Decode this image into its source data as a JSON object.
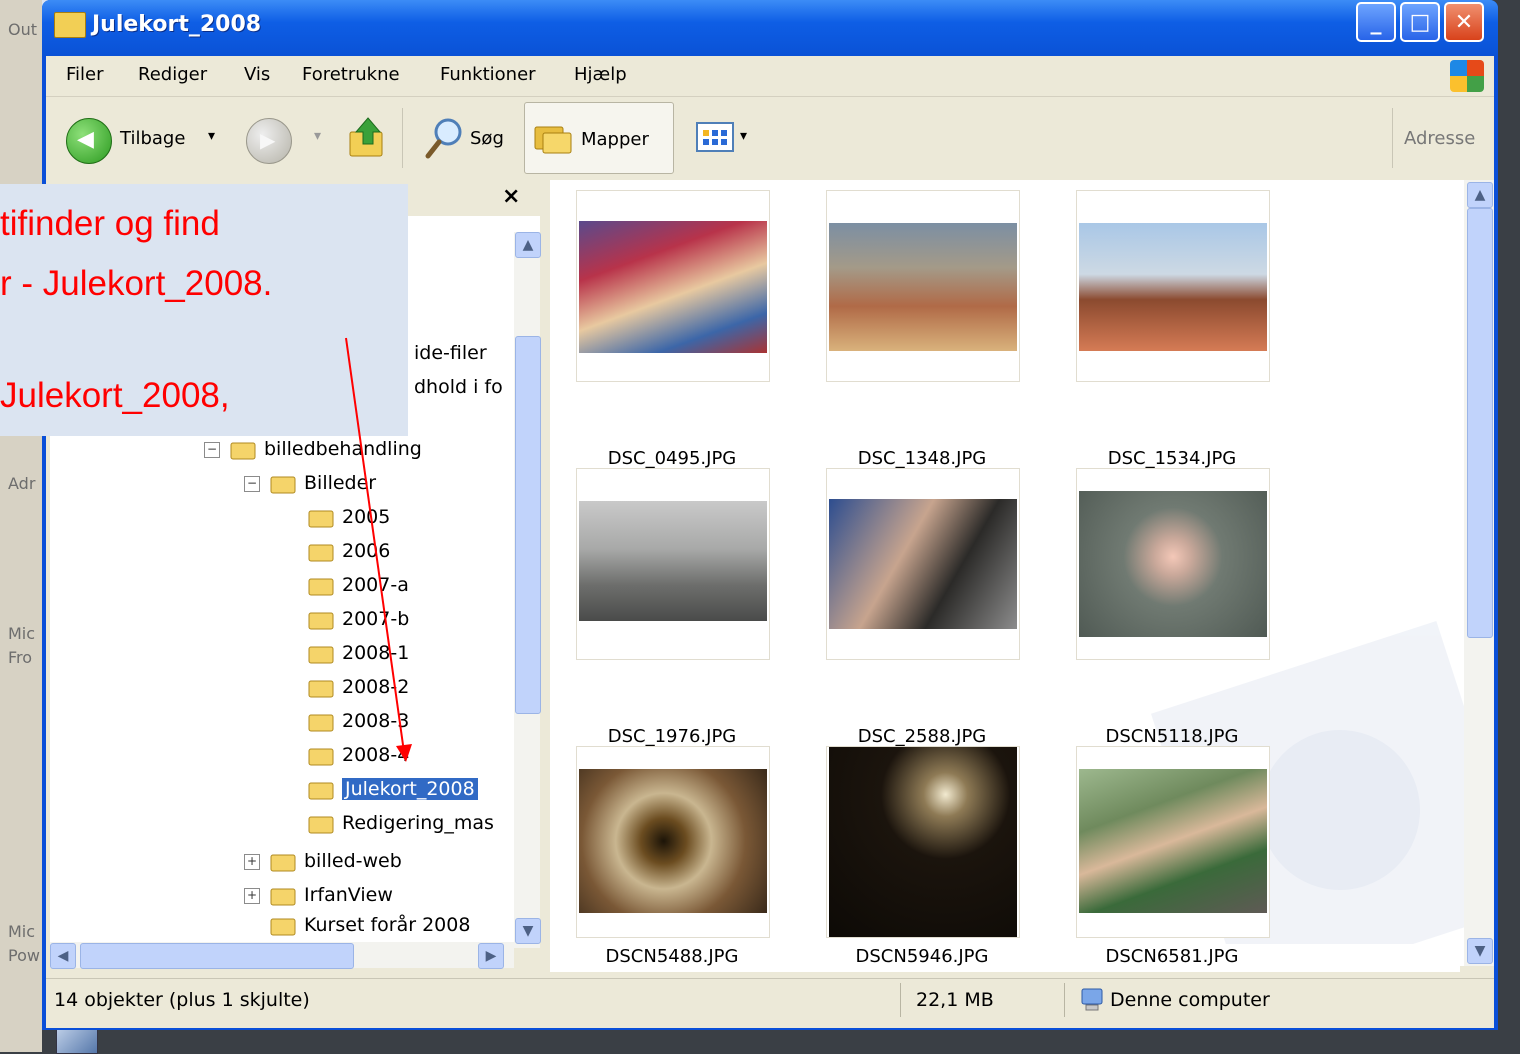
{
  "desktop": {
    "labels": [
      "Out",
      "Adr",
      "Mic",
      "Fro",
      "Mic",
      "Pow"
    ]
  },
  "window": {
    "title": "Julekort_2008",
    "buttons": {
      "min": "_",
      "max": "□",
      "close": "✕"
    }
  },
  "menu": {
    "items": [
      "Filer",
      "Rediger",
      "Vis",
      "Foretrukne",
      "Funktioner",
      "Hjælp"
    ]
  },
  "toolbar": {
    "back_label": "Tilbage",
    "dropdown_arrow": "▾",
    "search_label": "Søg",
    "folders_label": "Mapper",
    "address_label": "Adresse"
  },
  "folder_pane": {
    "close_label": "×",
    "partial_rows": [
      "ide-filer",
      "dhold i fo"
    ],
    "tree": [
      {
        "label": "billedbehandling",
        "expander": "−"
      },
      {
        "label": "Billeder",
        "expander": "−"
      },
      {
        "label": "2005"
      },
      {
        "label": "2006"
      },
      {
        "label": "2007-a"
      },
      {
        "label": "2007-b"
      },
      {
        "label": "2008-1"
      },
      {
        "label": "2008-2"
      },
      {
        "label": "2008-3"
      },
      {
        "label": "2008-4"
      },
      {
        "label": "Julekort_2008",
        "selected": true
      },
      {
        "label": "Redigering_mas"
      },
      {
        "label": "billed-web",
        "expander": "+"
      },
      {
        "label": "IrfanView",
        "expander": "+"
      },
      {
        "label": "Kurset forår 2008"
      }
    ]
  },
  "files": [
    {
      "name": "DSC_0495.JPG"
    },
    {
      "name": "DSC_1348.JPG"
    },
    {
      "name": "DSC_1534.JPG"
    },
    {
      "name": "DSC_1976.JPG"
    },
    {
      "name": "DSC_2588.JPG"
    },
    {
      "name": "DSCN5118.JPG"
    },
    {
      "name": "DSCN5488.JPG"
    },
    {
      "name": "DSCN5946.JPG"
    },
    {
      "name": "DSCN6581.JPG"
    }
  ],
  "status": {
    "objects": "14 objekter (plus 1 skjulte)",
    "size": "22,1 MB",
    "location": "Denne computer"
  },
  "callout": {
    "lines": [
      "tifinder og find",
      "r - Julekort_2008.",
      "Julekort_2008,"
    ],
    "color": "#ff0000"
  },
  "colors": {
    "titlebar": "#0a52d6",
    "selection": "#316ac5"
  }
}
